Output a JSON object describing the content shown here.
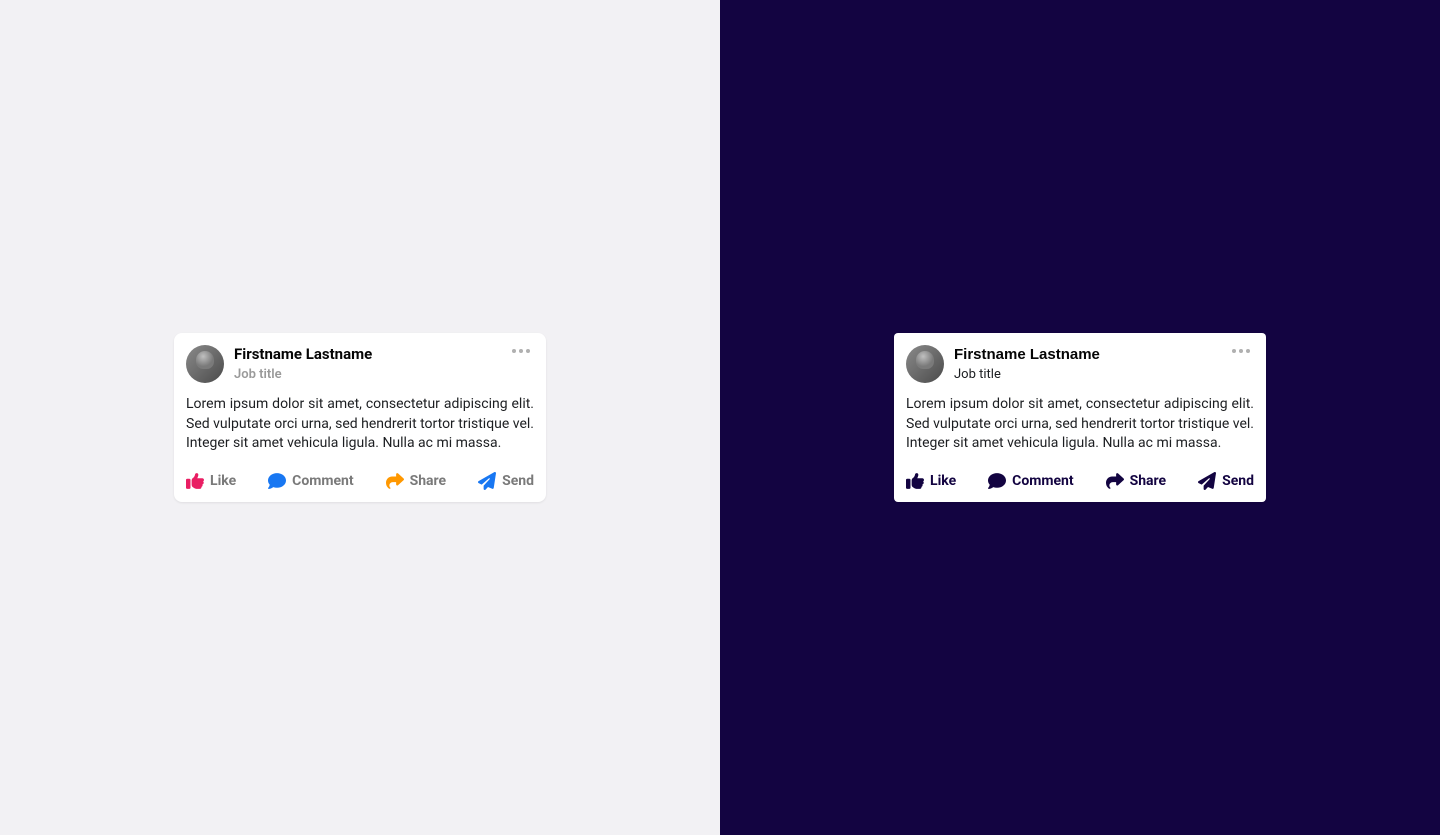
{
  "post": {
    "name": "Firstname Lastname",
    "subtitle": "Job title",
    "body": "Lorem ipsum dolor sit amet, consectetur adipiscing elit. Sed vulputate orci urna, sed hendrerit tortor tristique vel. Integer sit amet vehicula ligula. Nulla ac mi massa."
  },
  "actions": {
    "like": "Like",
    "comment": "Comment",
    "share": "Share",
    "send": "Send"
  },
  "colors": {
    "like": "#e91e63",
    "comment": "#1877f2",
    "share": "#ff9800",
    "send": "#1877f2",
    "dark_icon": "#130441"
  }
}
